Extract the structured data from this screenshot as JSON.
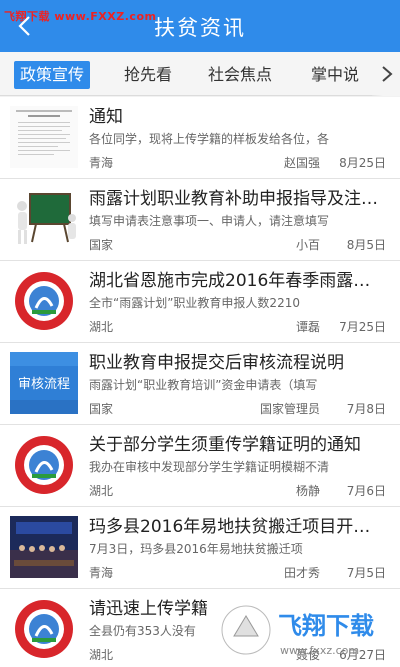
{
  "watermark": "飞翔下载 www.FXXZ.com",
  "header": {
    "title": "扶贫资讯",
    "back_icon": "back-arrow-icon"
  },
  "tabs": [
    {
      "label": "政策宣传",
      "active": true
    },
    {
      "label": "抢先看"
    },
    {
      "label": "社会焦点"
    },
    {
      "label": "掌中说"
    }
  ],
  "tabs_more_icon": "chevron-right-icon",
  "items": [
    {
      "title": "通知",
      "summary": "各位同学，现将上传学籍的样板发给各位，各",
      "source": "青海",
      "author": "赵国强",
      "date": "8月25日",
      "thumb": "document-thumb"
    },
    {
      "title": "雨露计划职业教育补助申报指导及注意…",
      "summary": "填写申请表注意事项一、申请人，请注意填写",
      "source": "国家",
      "author": "小百",
      "date": "8月5日",
      "thumb": "blackboard-thumb"
    },
    {
      "title": "湖北省恩施市完成2016年春季雨露…",
      "summary": "全市“雨露计划”职业教育申报人数2210",
      "source": "湖北",
      "author": "谭磊",
      "date": "7月25日",
      "thumb": "emblem-thumb"
    },
    {
      "title": "职业教育申报提交后审核流程说明",
      "summary": "雨露计划“职业教育培训”资金申请表（填写",
      "source": "国家",
      "author": "国家管理员",
      "date": "7月8日",
      "thumb": "review-thumb",
      "thumb_text": "审核流程"
    },
    {
      "title": "关于部分学生须重传学籍证明的通知",
      "summary": "我办在审核中发现部分学生学籍证明模糊不清",
      "source": "湖北",
      "author": "杨静",
      "date": "7月6日",
      "thumb": "emblem-thumb"
    },
    {
      "title": "玛多县2016年易地扶贫搬迁项目开…",
      "summary": "7月3日，玛多县2016年易地扶贫搬迁项",
      "source": "青海",
      "author": "田才秀",
      "date": "7月5日",
      "thumb": "meeting-thumb"
    },
    {
      "title": "请迅速上传学籍",
      "summary": "全县仍有353人没有",
      "source": "湖北",
      "author": "聂俊",
      "date": "6月27日",
      "thumb": "emblem-thumb"
    }
  ],
  "logo_watermark": {
    "text": "飞翔下载",
    "url": "www.fxxz.com"
  },
  "colors": {
    "primary": "#2f8bea",
    "watermark_red": "#e22222"
  }
}
